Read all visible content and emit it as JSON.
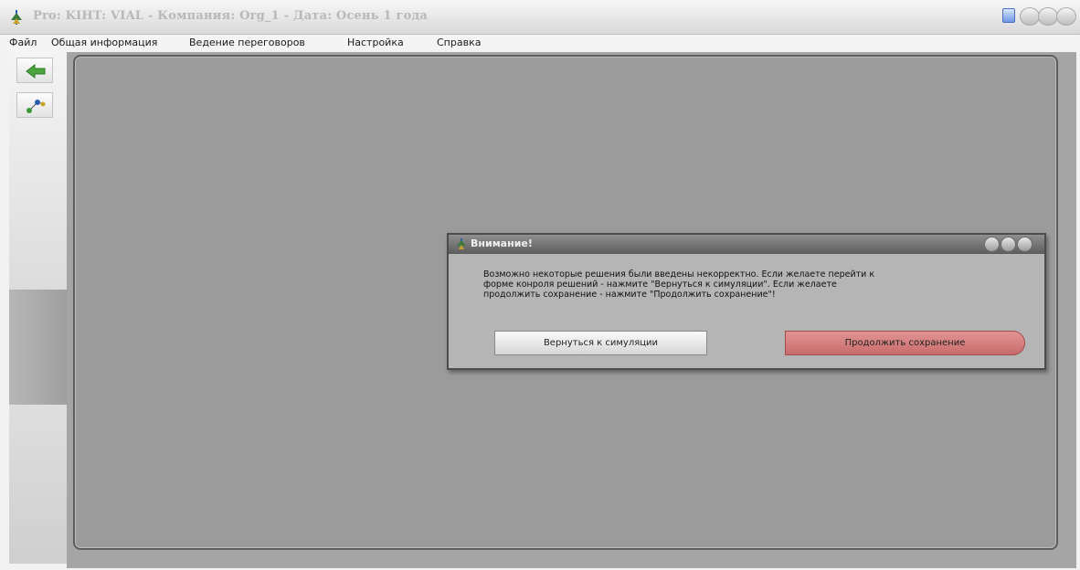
{
  "window": {
    "title": "Pro: KIHT: VIAL - Компания: Org_1 - Дата: Осень 1 года"
  },
  "menu": {
    "items": [
      {
        "label": "Файл"
      },
      {
        "label": "Общая информация"
      },
      {
        "label": "Ведение переговоров"
      },
      {
        "label": "Настройка"
      },
      {
        "label": "Справка"
      }
    ]
  },
  "toolbar": {
    "icons": [
      "back-arrow-icon",
      "network-nodes-icon"
    ]
  },
  "dialog": {
    "title": "Внимание!",
    "message_lines": [
      "Возможно некоторые решения были введены некорректно. Если желаете перейти к",
      "форме конроля решений - нажмите \"Вернуться  к симуляции\". Если желаете",
      "продолжить сохранение - нажмите \"Продолжить сохранение\"!"
    ],
    "return_button": "Вернуться к симуляции",
    "continue_button": "Продолжить сохранение"
  },
  "colors": {
    "workspace": "#9b9b9b",
    "dialog_titlebar": "#5c5c5c",
    "continue_button": "#d07a7a",
    "title_text": "#b8b8b8"
  }
}
